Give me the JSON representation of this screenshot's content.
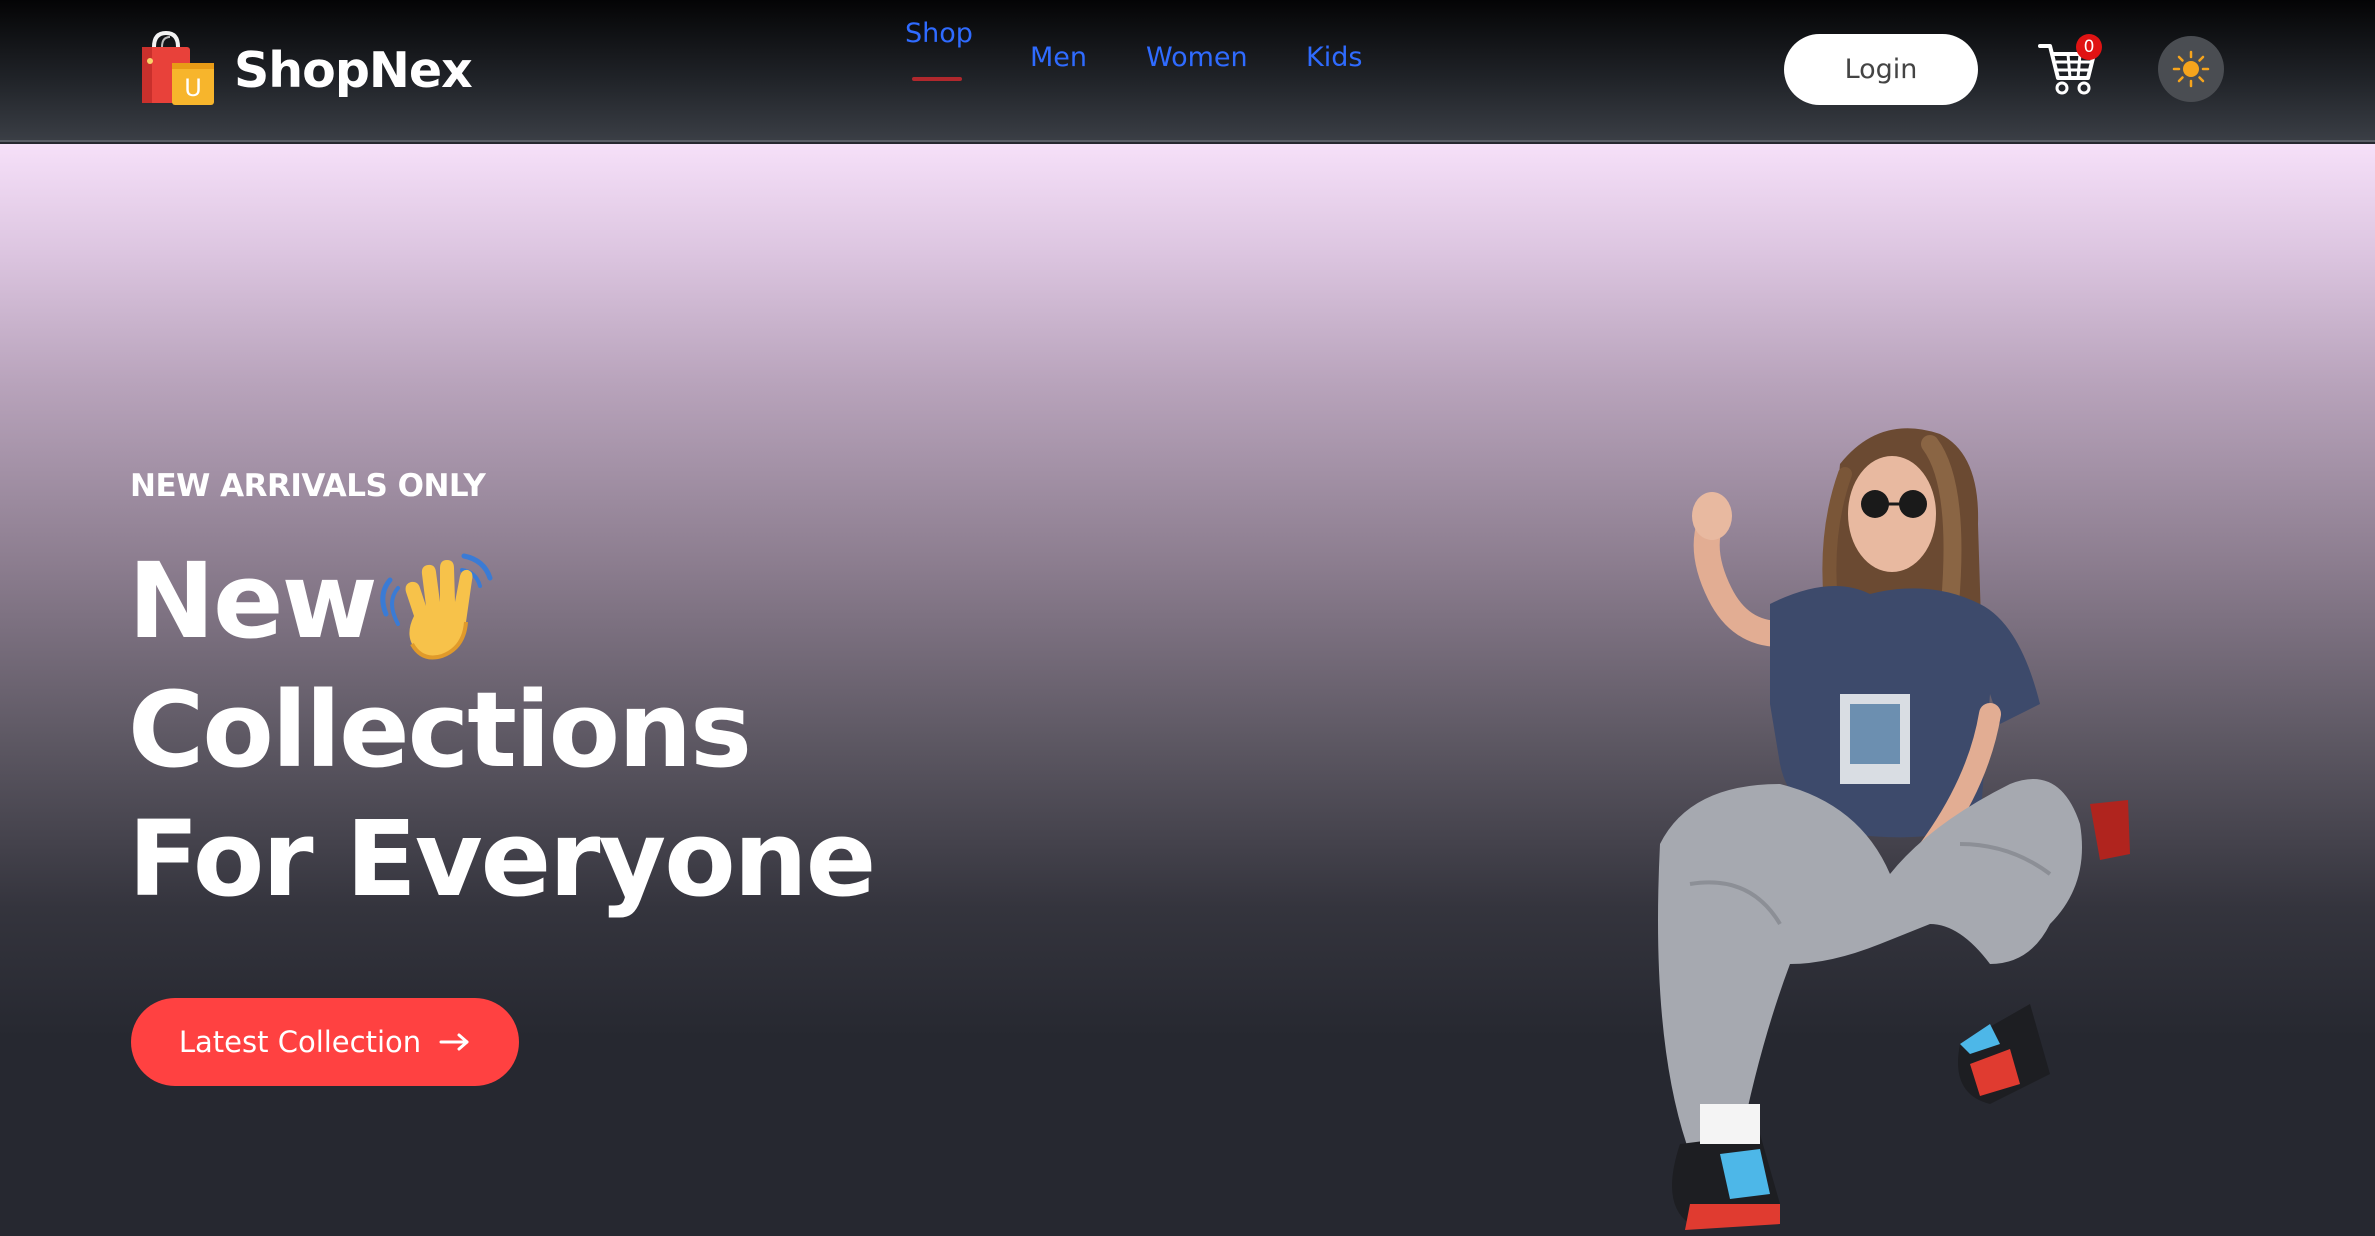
{
  "brand": {
    "name": "ShopNex",
    "logo_icon": "shopping-bag-icon",
    "logo_letter": "U"
  },
  "nav": {
    "links": [
      {
        "label": "Shop",
        "active": true
      },
      {
        "label": "Men",
        "active": false
      },
      {
        "label": "Women",
        "active": false
      },
      {
        "label": "Kids",
        "active": false
      }
    ],
    "active_color": "#2f6bff",
    "underline_color": "#b0282d"
  },
  "header": {
    "login_label": "Login",
    "cart_count": "0",
    "cart_icon": "cart-icon",
    "theme_icon": "sun-icon"
  },
  "hero": {
    "eyebrow": "NEW ARRIVALS ONLY",
    "title_lines": [
      "New",
      "Collections",
      "For Everyone"
    ],
    "title_emoji": "waving-hand-icon",
    "cta_label": "Latest Collection",
    "cta_icon": "arrow-right-icon",
    "cta_color": "#ff4141",
    "image_alt": "model-photo"
  }
}
